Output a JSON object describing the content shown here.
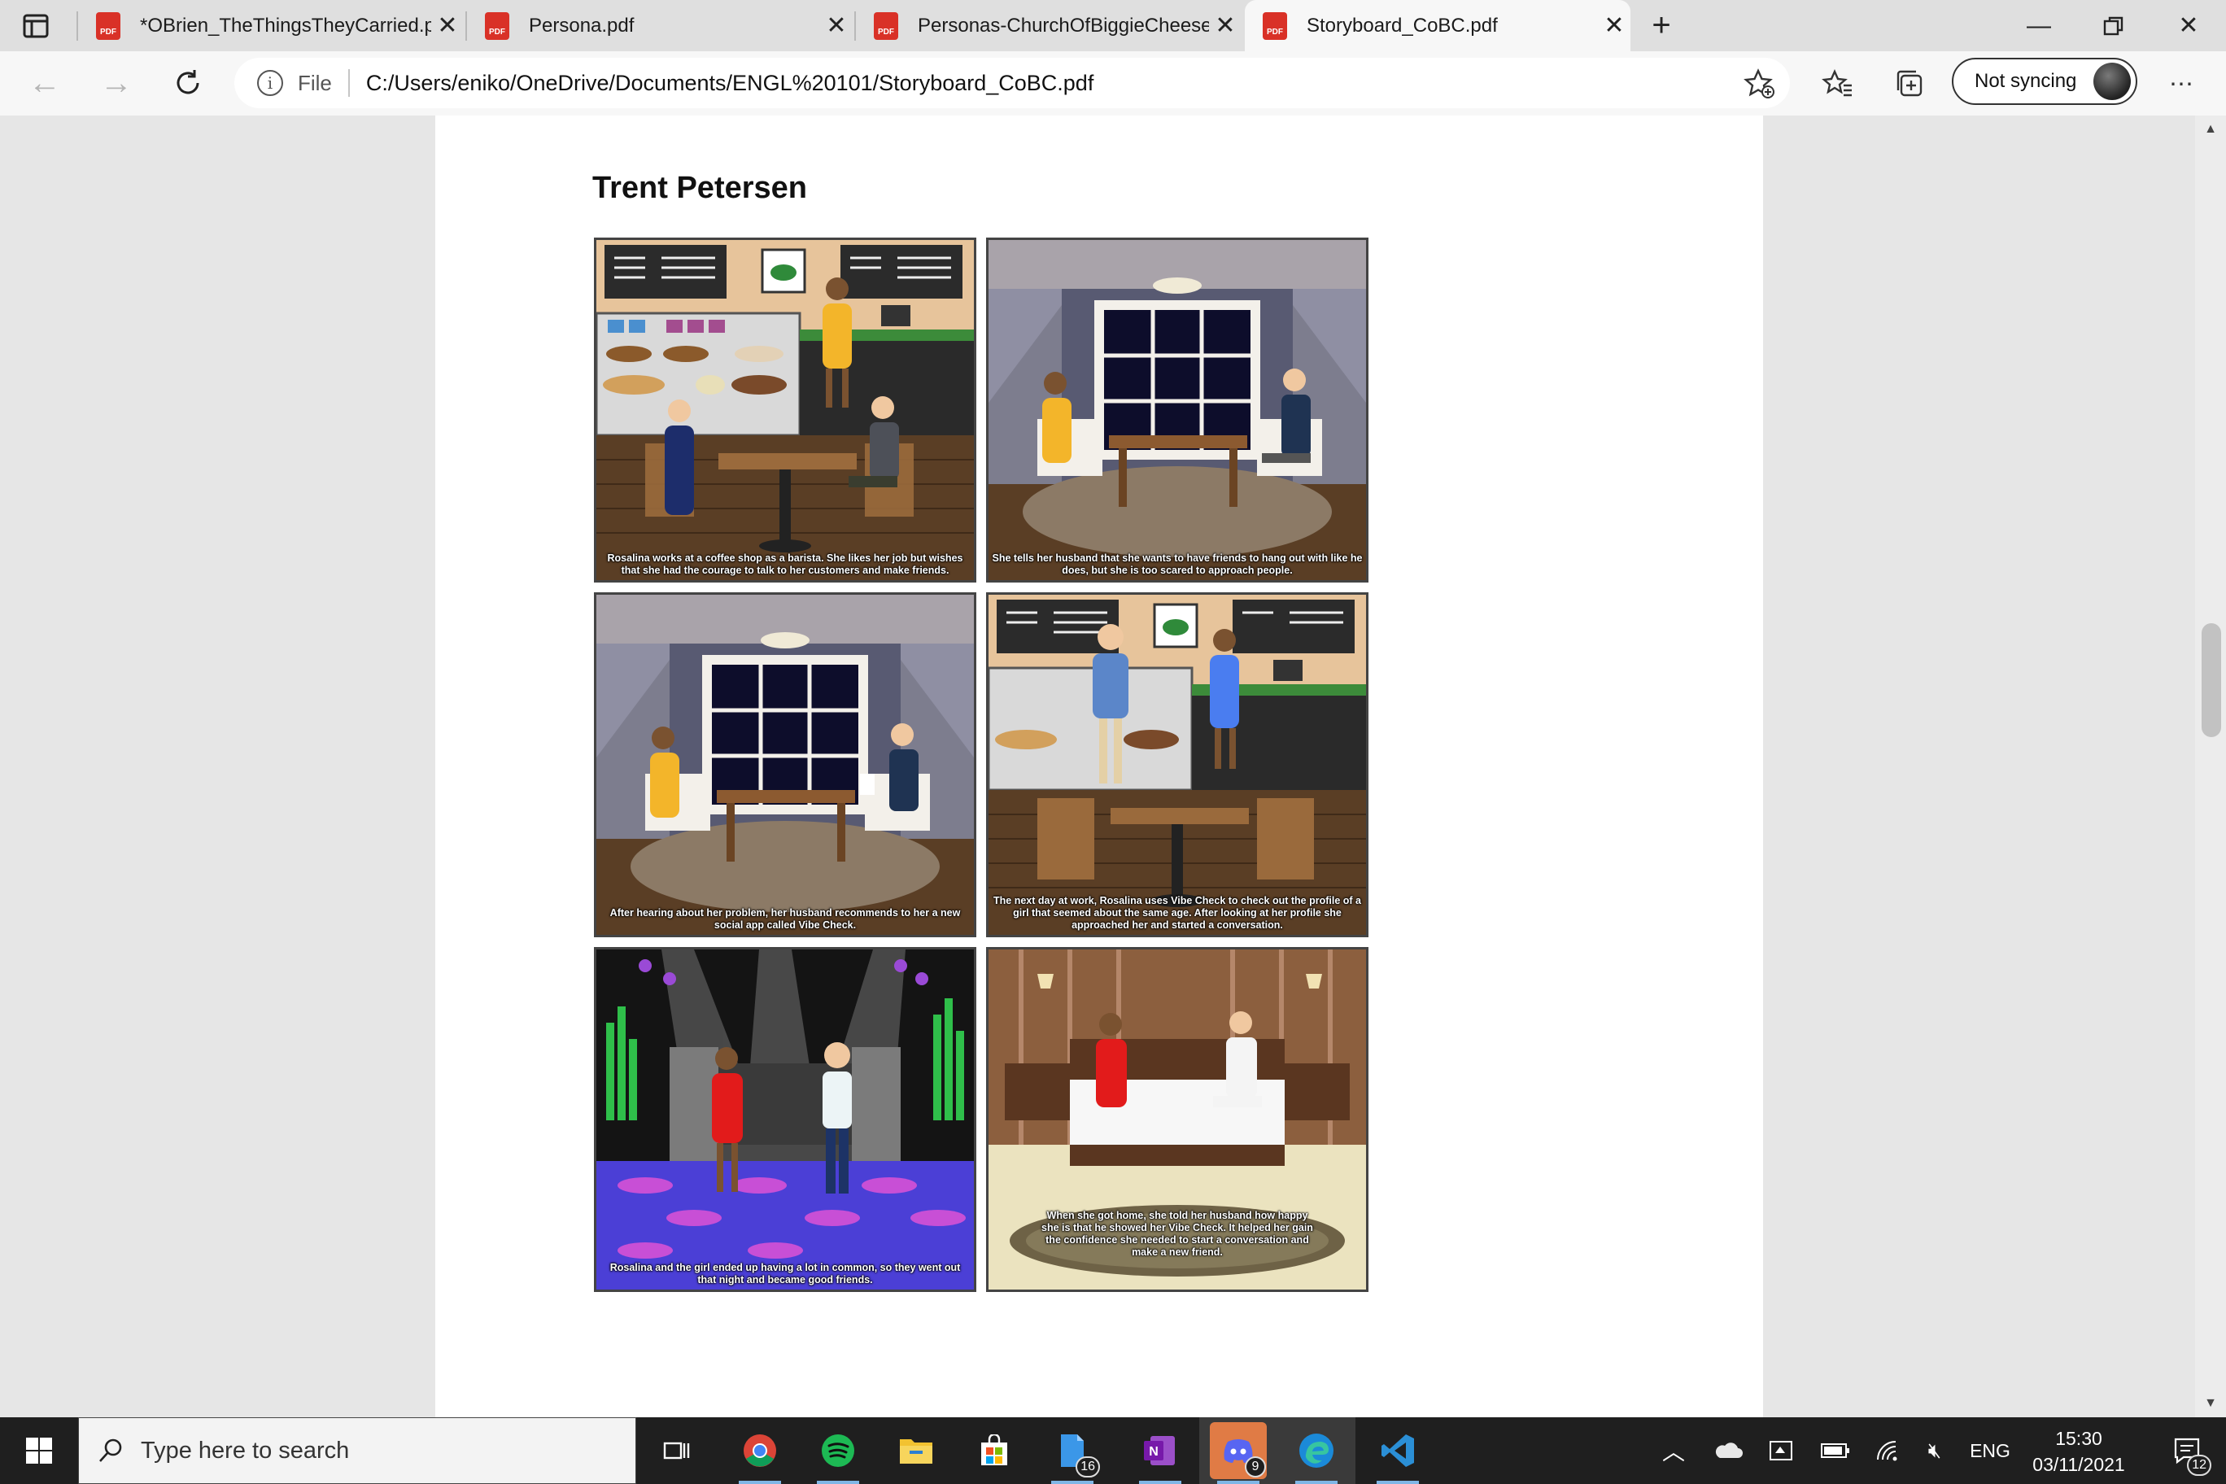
{
  "browser": {
    "tabs": [
      {
        "title": "*OBrien_TheThingsTheyCarried.pdf",
        "active": false
      },
      {
        "title": "Persona.pdf",
        "active": false
      },
      {
        "title": "Personas-ChurchOfBiggieCheese.pdf",
        "active": false
      },
      {
        "title": "Storyboard_CoBC.pdf",
        "active": true
      }
    ],
    "file_label": "File",
    "url": "C:/Users/eniko/OneDrive/Documents/ENGL%20101/Storyboard_CoBC.pdf",
    "sync_label": "Not syncing"
  },
  "document": {
    "heading": "Trent Petersen",
    "panels": [
      {
        "scene": "coffee-shop",
        "caption": "Rosalina works at a coffee shop as a barista. She likes her job but wishes that she had the courage to talk to her customers and make friends."
      },
      {
        "scene": "home",
        "caption": "She tells her husband that she wants to have friends to hang out with like he does, but she is too scared to approach people."
      },
      {
        "scene": "home",
        "caption": "After hearing about her problem, her husband recommends to her a new social app called Vibe Check."
      },
      {
        "scene": "coffee-shop",
        "caption": "The next day at work, Rosalina uses Vibe Check to check out the profile of a girl that seemed about the same age. After looking at her profile she approached her and started a conversation."
      },
      {
        "scene": "club",
        "caption": "Rosalina and the girl ended up having a lot in common, so they went out that night and became good friends."
      },
      {
        "scene": "bedroom",
        "caption": "When she got home, she told her husband how happy she is that he showed her Vibe Check. It helped her gain the confidence she needed to start a conversation and make a new friend."
      }
    ]
  },
  "taskbar": {
    "search_placeholder": "Type here to search",
    "badges": {
      "files": "16",
      "discord": "9",
      "notifications": "12"
    },
    "language": "ENG",
    "time": "15:30",
    "date": "03/11/2021"
  },
  "colors": {
    "pdf_red": "#d93127",
    "vscode_blue": "#2b8fd6",
    "edge_blue": "#1b8ad8"
  }
}
